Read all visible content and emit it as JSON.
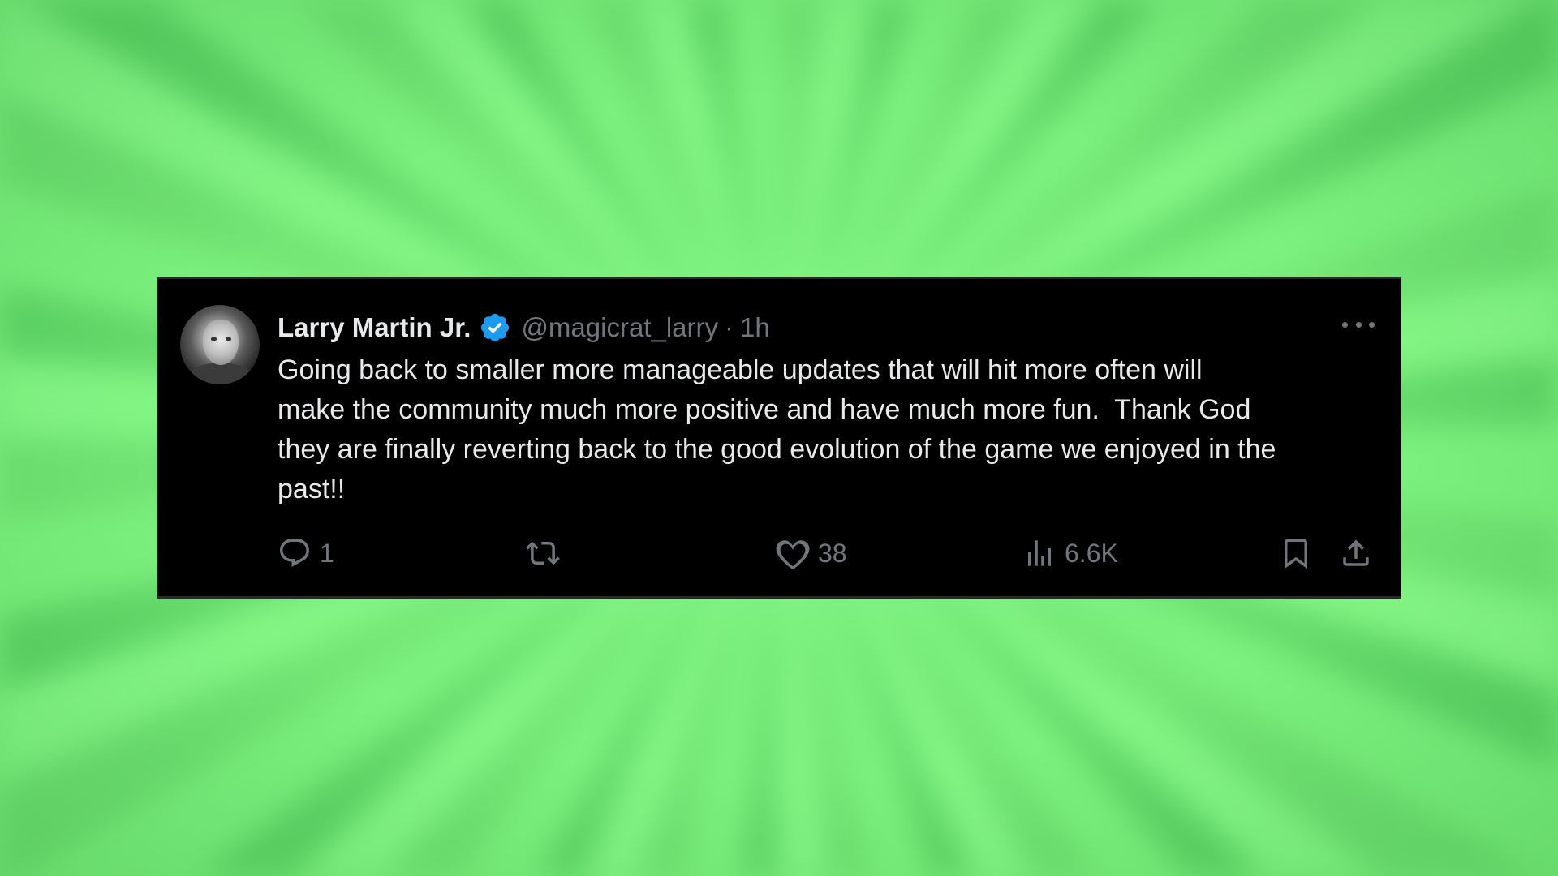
{
  "tweet": {
    "author_name": "Larry Martin Jr.",
    "handle": "@magicrat_larry",
    "separator": "·",
    "time": "1h",
    "body": "Going back to smaller more manageable updates that will hit more often will\nmake the community much more positive and have much more fun.  Thank God\nthey are finally reverting back to the good evolution of the game we enjoyed in the\npast!!",
    "icons": {
      "verified": "verified-badge-icon",
      "more": "more-icon",
      "reply": "reply-icon",
      "retweet": "retweet-icon",
      "like": "like-icon",
      "views": "views-icon",
      "bookmark": "bookmark-icon",
      "share": "share-icon"
    },
    "stats": {
      "replies": "1",
      "likes": "38",
      "views": "6.6K"
    }
  },
  "colors": {
    "background_green": "#7df07f",
    "card": "#000000",
    "text_primary": "#e7e9ea",
    "text_secondary": "#71767b",
    "verified_blue": "#1d9bf0"
  }
}
